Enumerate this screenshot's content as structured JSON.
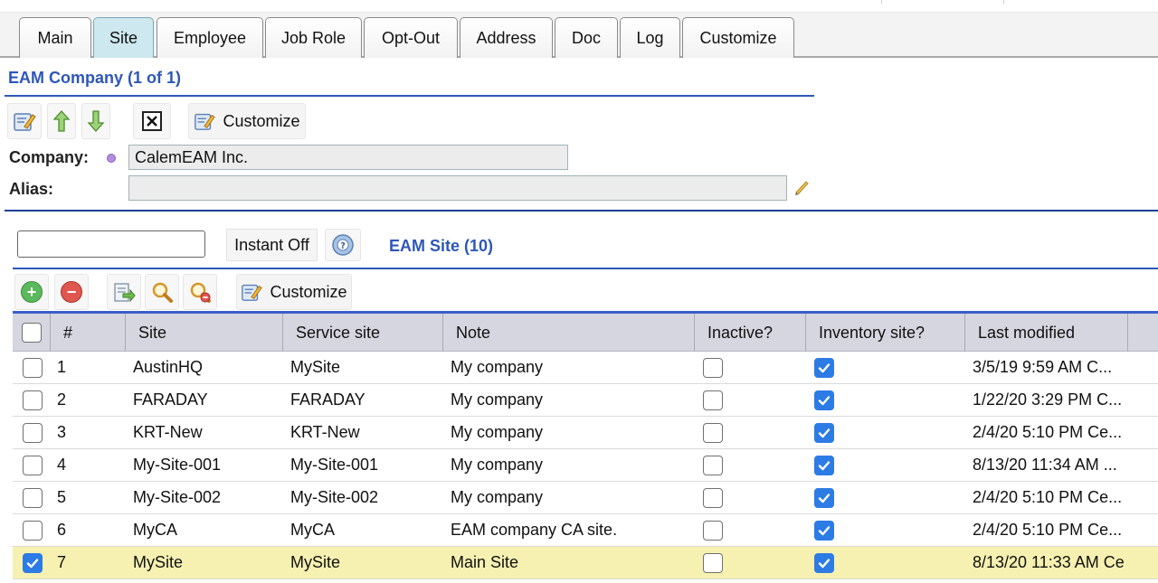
{
  "tabs": [
    "Main",
    "Site",
    "Employee",
    "Job Role",
    "Opt-Out",
    "Address",
    "Doc",
    "Log",
    "Customize"
  ],
  "active_tab": "Site",
  "company_section": {
    "title": "EAM Company (1 of 1)",
    "toolbar": {
      "customize_label": "Customize"
    },
    "company_label": "Company:",
    "company_value": "CalemEAM Inc.",
    "alias_label": "Alias:",
    "alias_value": ""
  },
  "site_section": {
    "search_value": "",
    "instant_label": "Instant Off",
    "title": "EAM Site (10)",
    "toolbar": {
      "customize_label": "Customize"
    }
  },
  "grid": {
    "columns": [
      "#",
      "Site",
      "Service site",
      "Note",
      "Inactive?",
      "Inventory site?",
      "Last modified"
    ],
    "rows": [
      {
        "num": "1",
        "site": "AustinHQ",
        "service_site": "MySite",
        "note": "My company",
        "inactive": false,
        "inventory": true,
        "last_modified": "3/5/19 9:59 AM C...",
        "selected": false
      },
      {
        "num": "2",
        "site": "FARADAY",
        "service_site": "FARADAY",
        "note": "My company",
        "inactive": false,
        "inventory": true,
        "last_modified": "1/22/20 3:29 PM C...",
        "selected": false
      },
      {
        "num": "3",
        "site": "KRT-New",
        "service_site": "KRT-New",
        "note": "My company",
        "inactive": false,
        "inventory": true,
        "last_modified": "2/4/20 5:10 PM Ce...",
        "selected": false
      },
      {
        "num": "4",
        "site": "My-Site-001",
        "service_site": "My-Site-001",
        "note": "My company",
        "inactive": false,
        "inventory": true,
        "last_modified": "8/13/20 11:34 AM ...",
        "selected": false
      },
      {
        "num": "5",
        "site": "My-Site-002",
        "service_site": "My-Site-002",
        "note": "My company",
        "inactive": false,
        "inventory": true,
        "last_modified": "2/4/20 5:10 PM Ce...",
        "selected": false
      },
      {
        "num": "6",
        "site": "MyCA",
        "service_site": "MyCA",
        "note": "EAM company CA site.",
        "inactive": false,
        "inventory": true,
        "last_modified": "2/4/20 5:10 PM Ce...",
        "selected": false
      },
      {
        "num": "7",
        "site": "MySite",
        "service_site": "MySite",
        "note": "Main Site",
        "inactive": false,
        "inventory": true,
        "last_modified": "8/13/20 11:33 AM Ce",
        "selected": true
      }
    ]
  },
  "colors": {
    "accent_blue": "#2e57b8",
    "active_tab": "#cde8ee",
    "selected_row": "#f6f1b0",
    "checkbox_on": "#2d7be5",
    "grid_header": "#d6d6e0"
  }
}
